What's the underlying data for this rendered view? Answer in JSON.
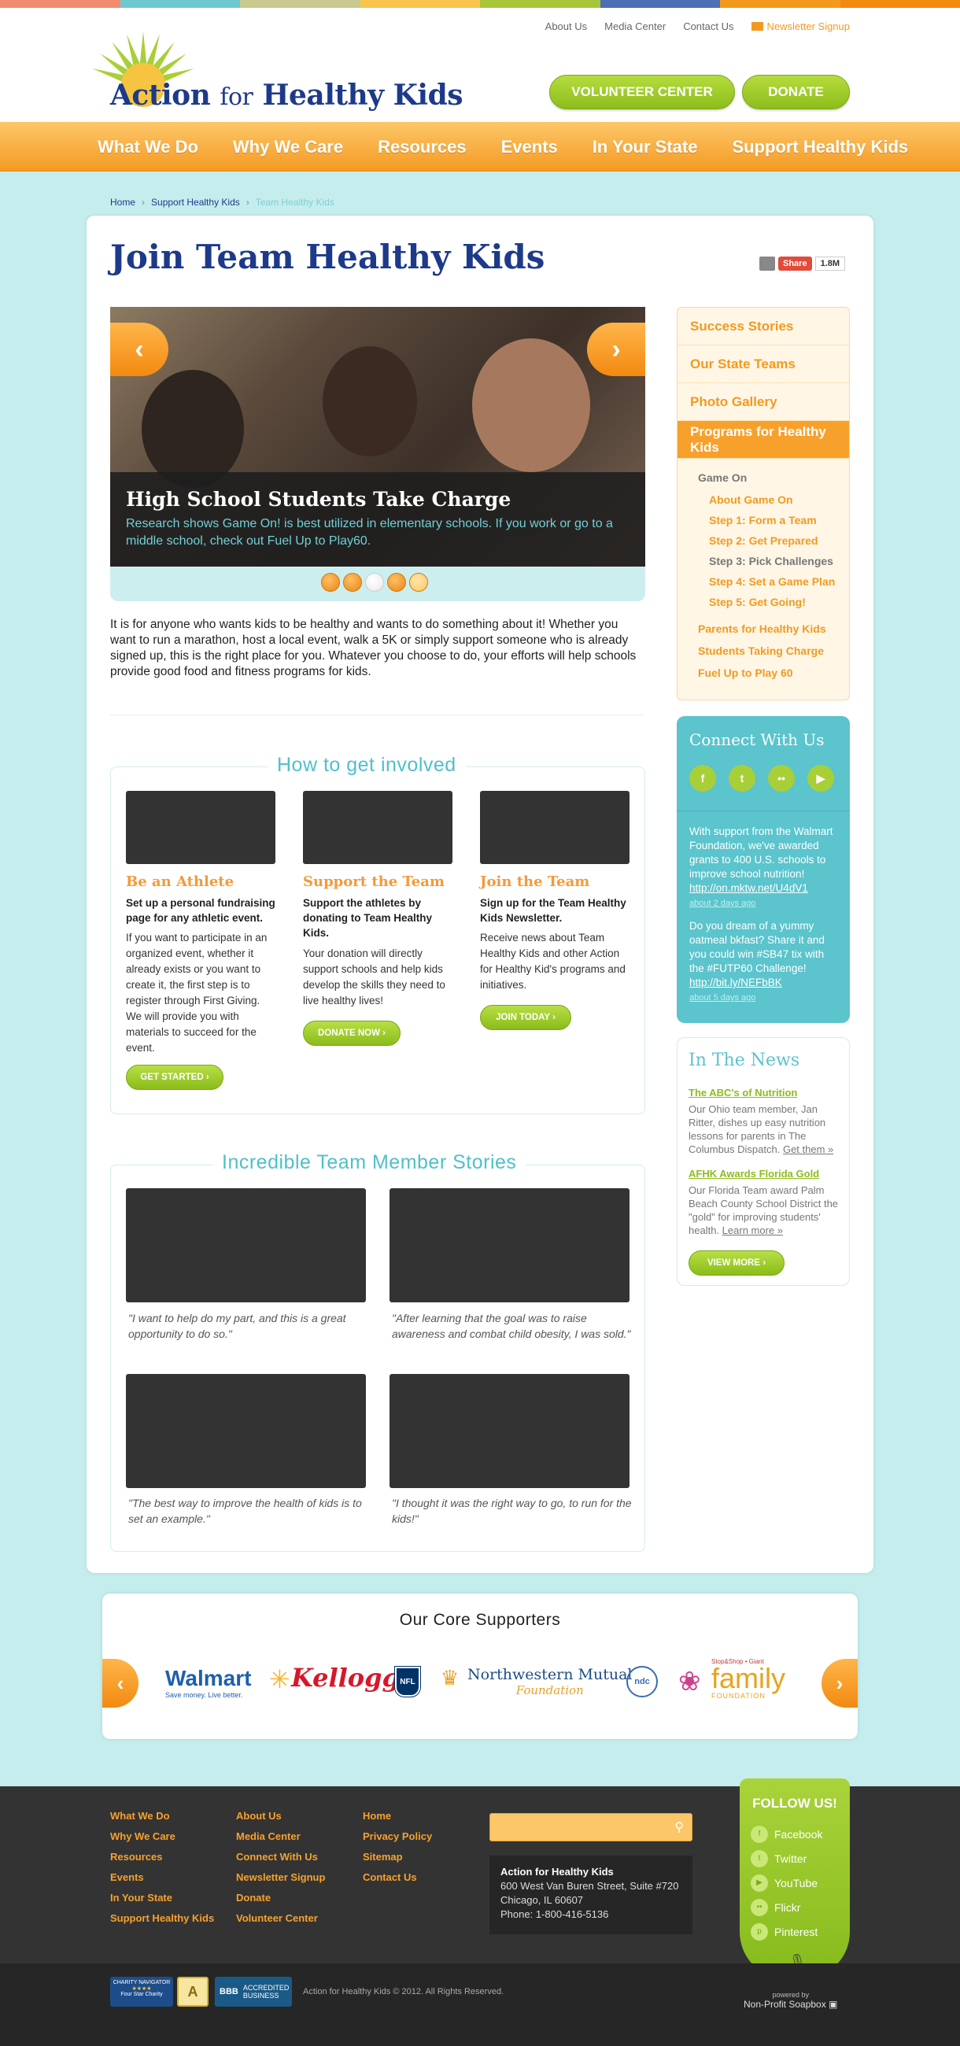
{
  "colors": {
    "navy": "#1d3a8a",
    "orange": "#f39a1e",
    "green": "#8cbd1c",
    "teal": "#5bc4cc",
    "bg": "#c5eded"
  },
  "header": {
    "top_links": [
      "About Us",
      "Media Center",
      "Contact Us"
    ],
    "newsletter": "Newsletter Signup",
    "logo_text_a": "Action",
    "logo_text_b": "for",
    "logo_text_c": "Healthy Kids",
    "volunteer": "VOLUNTEER CENTER",
    "donate": "DONATE"
  },
  "nav": [
    "What We Do",
    "Why We Care",
    "Resources",
    "Events",
    "In Your State",
    "Support Healthy Kids"
  ],
  "breadcrumb": [
    "Home",
    "Support Healthy Kids",
    "Team Healthy Kids"
  ],
  "page_title": "Join Team Healthy Kids",
  "share": {
    "label": "Share",
    "count": "1.8M"
  },
  "slider": {
    "heading": "High School Students Take Charge",
    "text": "Research shows Game On! is best utilized in elementary schools. If you work or go to a middle school, check out Fuel Up to Play60."
  },
  "intro": "It is for anyone who wants kids to be healthy and wants to do something about it! Whether you want to run a marathon, host a local event, walk a 5K or simply support someone who is already signed up, this is the right place for you. Whatever you choose to do, your efforts will help schools provide good food and fitness programs for kids.",
  "involved": {
    "title": "How to get involved",
    "cols": [
      {
        "title": "Be an Athlete",
        "lead": "Set up a personal fundraising page for any athletic event.",
        "body": "If you want to participate in an organized event, whether it already exists or you want to create it, the first step is to register through First Giving. We will provide you with materials to succeed for the event.",
        "button": "GET STARTED ›"
      },
      {
        "title": "Support the Team",
        "lead": "Support the athletes by donating to Team Healthy Kids.",
        "body": "Your donation will directly support schools and help kids develop the skills they need to live healthy lives!",
        "button": "DONATE NOW ›"
      },
      {
        "title": "Join the Team",
        "lead": "Sign up for the Team Healthy Kids Newsletter.",
        "body": "Receive news about Team Healthy Kids and other Action for Healthy Kid's programs and initiatives.",
        "button": "JOIN TODAY ›"
      }
    ]
  },
  "stories": {
    "title": "Incredible Team Member Stories",
    "quotes": [
      "\"I want to help do my part, and this is a great opportunity to do so.\"",
      "\"After learning that the goal was to raise awareness and combat child obesity, I was sold.\"",
      "\"The best way to improve the health of kids is to set an example.\"",
      "\"I thought it was the right way to go, to run for the kids!\""
    ]
  },
  "sidebar": {
    "items": [
      "Success Stories",
      "Our State Teams",
      "Photo Gallery",
      "Programs for Healthy Kids"
    ],
    "game_on": "Game On",
    "sub_items": [
      "About Game On",
      "Step 1: Form a Team",
      "Step 2: Get Prepared",
      "Step 3: Pick Challenges",
      "Step 4: Set a Game Plan",
      "Step 5: Get Going!"
    ],
    "more_items": [
      "Parents for Healthy Kids",
      "Students Taking Charge",
      "Fuel Up to Play 60"
    ]
  },
  "connect": {
    "title": "Connect With Us",
    "icons": [
      "facebook-icon",
      "twitter-icon",
      "flickr-icon",
      "youtube-icon"
    ],
    "tweets": [
      {
        "text": "With support from the Walmart Foundation, we've awarded grants to 400 U.S. schools to improve school nutrition!",
        "link": "http://on.mktw.net/U4dV1",
        "time": "about 2 days ago"
      },
      {
        "text": "Do you dream of a yummy oatmeal bkfast? Share it and you could win #SB47 tix with the #FUTP60 Challenge!",
        "link": "http://bit.ly/NEFbBK",
        "time": "about 5 days ago"
      }
    ]
  },
  "news": {
    "title": "In The News",
    "items": [
      {
        "head": "The ABC's of Nutrition",
        "text": "Our Ohio team member, Jan Ritter, dishes up easy nutrition lessons for parents in The Columbus Dispatch.",
        "more": "Get them »"
      },
      {
        "head": "AFHK Awards Florida Gold",
        "text": "Our Florida Team award Palm Beach County School District the \"gold\" for improving students' health.",
        "more": "Learn more »"
      }
    ],
    "button": "VIEW MORE ›"
  },
  "supporters": {
    "title": "Our Core Supporters",
    "walmart": "Walmart",
    "walmart_tag": "Save money. Live better.",
    "kelloggs": "Kellogg's",
    "nfl": "NFL",
    "nm": "Northwestern Mutual",
    "nm_sub": "Foundation",
    "ndc": "ndc",
    "family_top": "Stop&Shop • Giant",
    "family": "family",
    "family_sub": "FOUNDATION"
  },
  "footer": {
    "col1": [
      "What We Do",
      "Why We Care",
      "Resources",
      "Events",
      "In Your State",
      "Support Healthy Kids"
    ],
    "col2": [
      "About Us",
      "Media Center",
      "Connect With Us",
      "Newsletter Signup",
      "Donate",
      "Volunteer Center"
    ],
    "col3": [
      "Home",
      "Privacy Policy",
      "Sitemap",
      "Contact Us"
    ],
    "org": "Action for Healthy Kids",
    "addr1": "600 West Van Buren Street, Suite #720",
    "addr2": "Chicago, IL 60607",
    "phone": "Phone: 1-800-416-5136",
    "follow_title": "FOLLOW US!",
    "follow": [
      "Facebook",
      "Twitter",
      "YouTube",
      "Flickr",
      "Pinterest"
    ],
    "copyright": "Action for Healthy Kids © 2012. All Rights Reserved.",
    "powered_by": "powered by",
    "soapbox": "Non-Profit Soapbox",
    "badge_cn": "CHARITY NAVIGATOR",
    "badge_cn_sub": "Four Star Charity",
    "badge_bbb": "ACCREDITED BUSINESS"
  }
}
